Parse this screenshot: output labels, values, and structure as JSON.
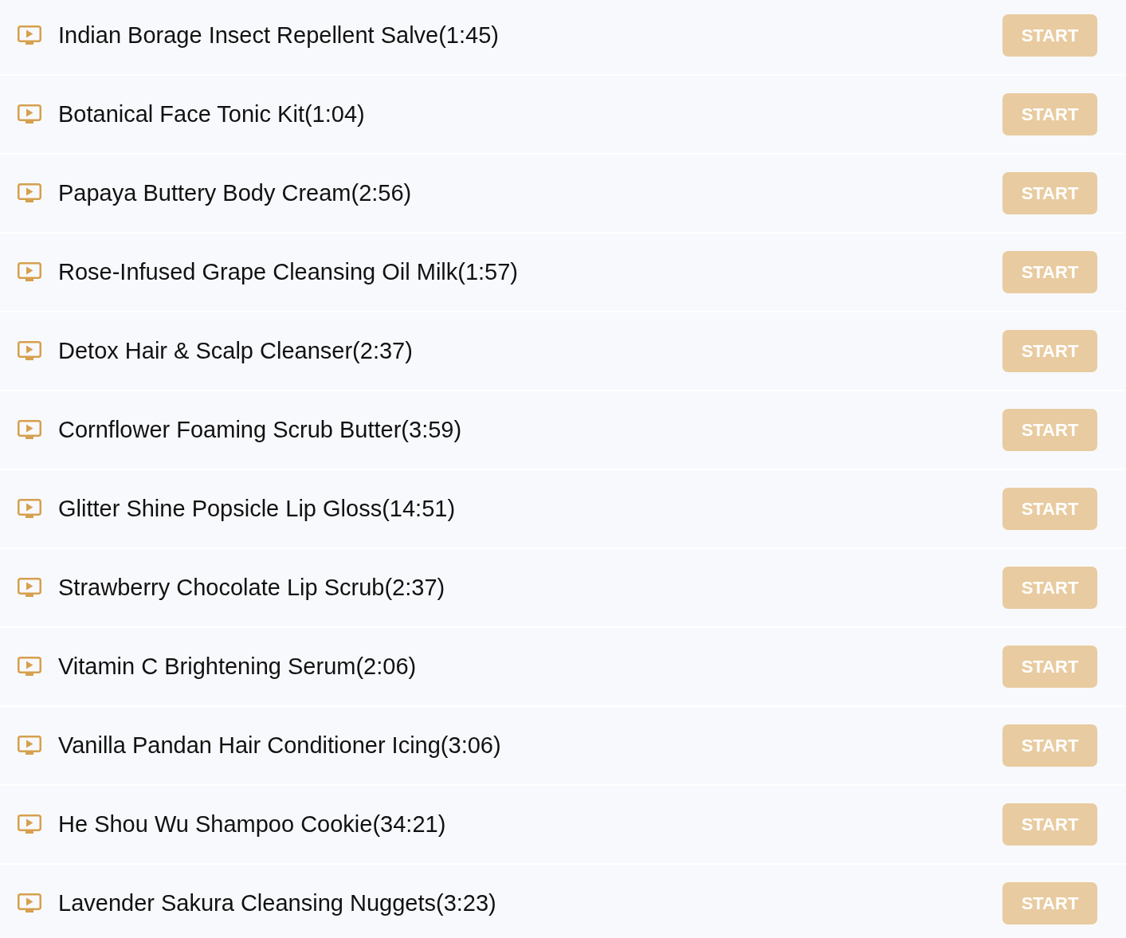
{
  "lessons": [
    {
      "title": "Indian Borage Insect Repellent Salve(1:45)",
      "button": "START"
    },
    {
      "title": "Botanical Face Tonic Kit(1:04)",
      "button": "START"
    },
    {
      "title": "Papaya Buttery Body Cream(2:56)",
      "button": "START"
    },
    {
      "title": "Rose-Infused Grape Cleansing Oil Milk(1:57)",
      "button": "START"
    },
    {
      "title": "Detox Hair & Scalp Cleanser(2:37)",
      "button": "START"
    },
    {
      "title": "Cornflower Foaming Scrub Butter(3:59)",
      "button": "START"
    },
    {
      "title": "Glitter Shine Popsicle Lip Gloss(14:51)",
      "button": "START"
    },
    {
      "title": "Strawberry Chocolate Lip Scrub(2:37)",
      "button": "START"
    },
    {
      "title": "Vitamin C Brightening Serum(2:06)",
      "button": "START"
    },
    {
      "title": "Vanilla Pandan Hair Conditioner Icing(3:06)",
      "button": "START"
    },
    {
      "title": "He Shou Wu Shampoo Cookie(34:21)",
      "button": "START"
    },
    {
      "title": "Lavender Sakura Cleansing Nuggets(3:23)",
      "button": "START"
    }
  ]
}
